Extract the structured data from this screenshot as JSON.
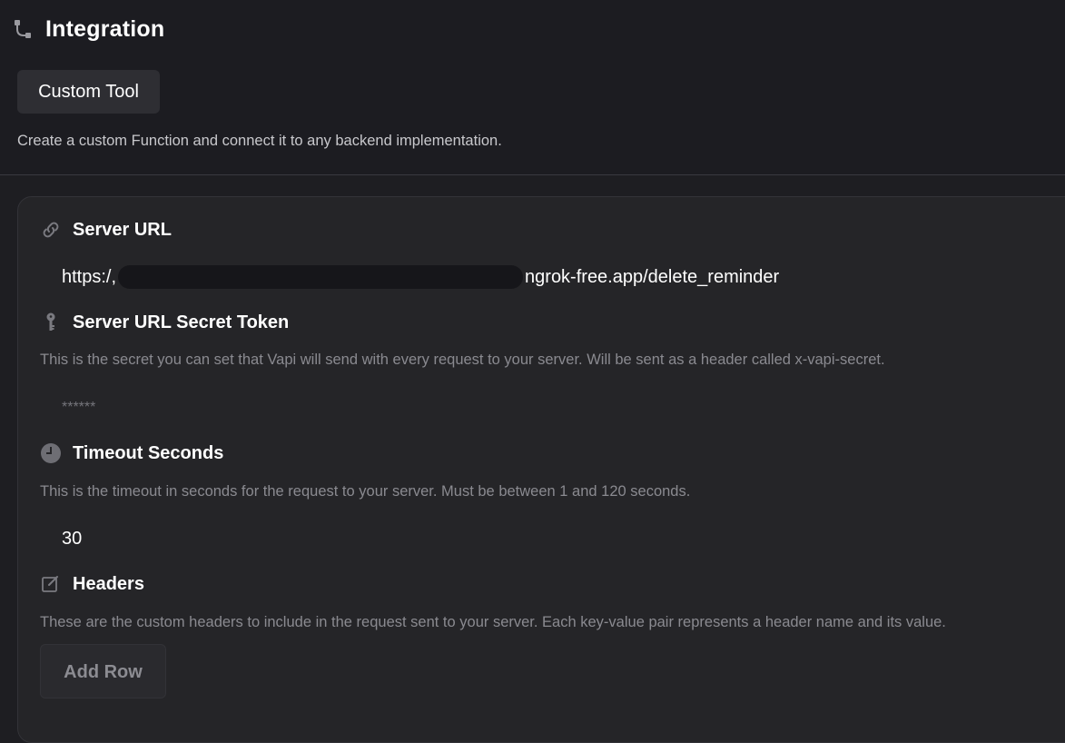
{
  "header": {
    "title": "Integration",
    "title_icon": "integration-icon",
    "tool_button_label": "Custom Tool",
    "description": "Create a custom Function and connect it to any backend implementation."
  },
  "server_url": {
    "label": "Server URL",
    "icon": "link-icon",
    "value_prefix": "https:/,",
    "value_suffix": "ngrok-free.app/delete_reminder"
  },
  "secret_token": {
    "label": "Server URL Secret Token",
    "icon": "key-icon",
    "description": "This is the secret you can set that Vapi will send with every request to your server. Will be sent as a header called x-vapi-secret.",
    "placeholder": "******"
  },
  "timeout": {
    "label": "Timeout Seconds",
    "icon": "clock-icon",
    "description": "This is the timeout in seconds for the request to your server. Must be between 1 and 120 seconds.",
    "value": "30"
  },
  "headers": {
    "label": "Headers",
    "icon": "edit-icon",
    "description": "These are the custom headers to include in the request sent to your server. Each key-value pair represents a header name and its value.",
    "add_row_label": "Add Row"
  },
  "colors": {
    "background": "#1e1e22",
    "card": "#252528",
    "muted_text": "#8a8a90"
  }
}
